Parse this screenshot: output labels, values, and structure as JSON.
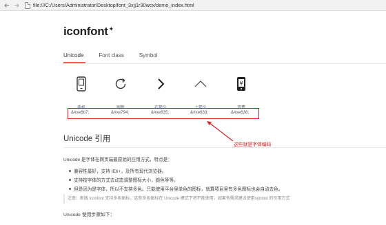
{
  "browser": {
    "back_icon": "back-arrow-icon",
    "forward_icon": "forward-arrow-icon",
    "url": "file:///C:/Users/Administrator/Desktop/font_3xjj1r30wcx/demo_index.html"
  },
  "page": {
    "logo": "iconfont",
    "logo_mark": "✦",
    "tabs": [
      {
        "label": "Unicode",
        "active": true
      },
      {
        "label": "Font class",
        "active": false
      },
      {
        "label": "Symbol",
        "active": false
      }
    ],
    "icons": [
      {
        "icon": "phone-icon",
        "name": "手机",
        "code": "&#xe6b7;"
      },
      {
        "icon": "refresh-icon",
        "name": "刷新",
        "code": "&#xe794;"
      },
      {
        "icon": "right-arrow-icon",
        "name": "右箭头",
        "code": "&#xe635;"
      },
      {
        "icon": "up-arrow-icon",
        "name": "上箭头",
        "code": "&#xe633;"
      },
      {
        "icon": "money-icon",
        "name": "资费",
        "code": "&#xe638;"
      }
    ],
    "annotation": "这些就是字体编码",
    "section_title": "Unicode 引用",
    "intro": "Unicode 是字体在网页端最原始的应用方式，特点是：",
    "bullets": [
      "兼容性最好，支持 IE6+，及所有现代浏览器。",
      "支持按字体的方式去动态调整图标大小，颜色等等。",
      "但是因为是字体，所以不支持多色。只能使用平台里单色的图标，就算项目里有多色图标也会自动去色。"
    ],
    "note": "注意：新版 iconfont 支持多色图标，这些多色图标在 Unicode 模式下将不能使用，如果有需求建议使用symbol 的引用方式",
    "steps_label": "Unicode 使用步骤如下："
  },
  "colors": {
    "accent": "#f0604a",
    "highlight": "#e02020"
  }
}
